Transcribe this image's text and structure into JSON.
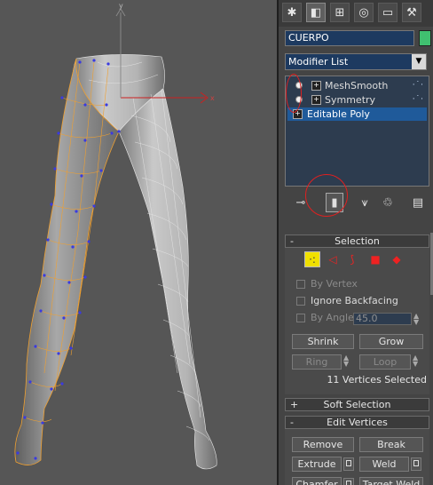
{
  "viewport": {
    "axis_labels": {
      "x": "x",
      "y": "y"
    }
  },
  "panel": {
    "tabs": [
      {
        "icon": "create-tab-icon",
        "glyph": "✱"
      },
      {
        "icon": "modify-tab-icon",
        "glyph": "◧"
      },
      {
        "icon": "hierarchy-tab-icon",
        "glyph": "⊞"
      },
      {
        "icon": "motion-tab-icon",
        "glyph": "◎"
      },
      {
        "icon": "display-tab-icon",
        "glyph": "▭"
      },
      {
        "icon": "utilities-tab-icon",
        "glyph": "⚒"
      }
    ],
    "object_name": "CUERPO",
    "object_color": "#40c070",
    "modifier_list": "Modifier List",
    "stack": [
      {
        "label": "MeshSmooth",
        "type": "modifier"
      },
      {
        "label": "Symmetry",
        "type": "modifier"
      },
      {
        "label": "Editable Poly",
        "type": "base"
      }
    ],
    "selection": {
      "title": "Selection",
      "toggle": "-",
      "by_vertex": "By Vertex",
      "ignore_backfacing": "Ignore Backfacing",
      "by_angle": "By Angle:",
      "angle_value": "45.0",
      "shrink": "Shrink",
      "grow": "Grow",
      "ring": "Ring",
      "loop": "Loop",
      "status": "11 Vertices Selected"
    },
    "soft_selection": {
      "title": "Soft Selection",
      "toggle": "+"
    },
    "edit_vertices": {
      "title": "Edit Vertices",
      "toggle": "-",
      "remove": "Remove",
      "break": "Break",
      "extrude": "Extrude",
      "weld": "Weld",
      "chamfer": "Chamfer",
      "target_weld": "Target Weld"
    }
  }
}
